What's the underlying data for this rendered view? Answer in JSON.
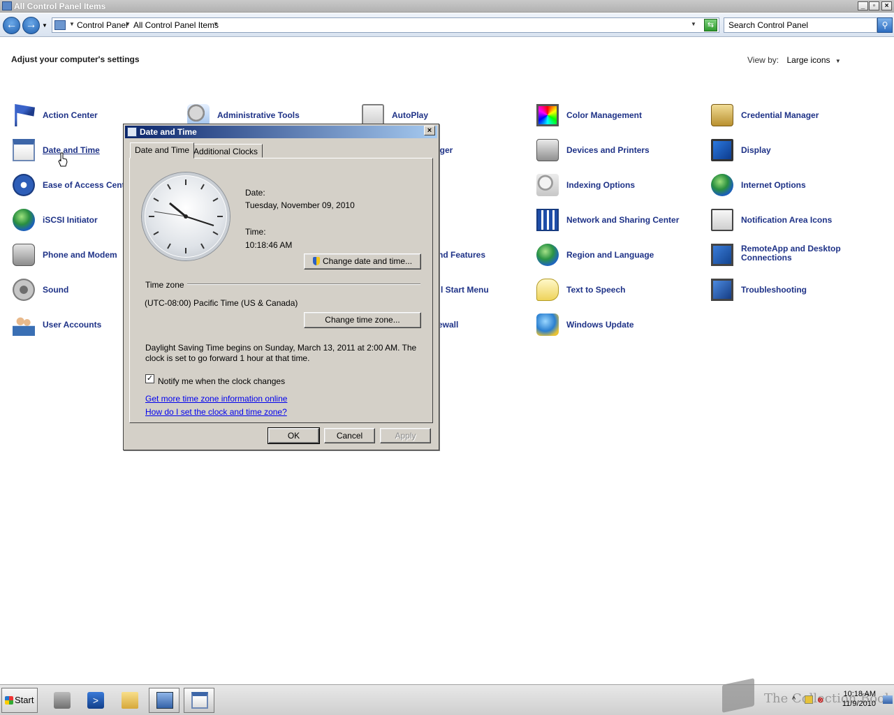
{
  "window": {
    "title": "All Control Panel Items"
  },
  "address": {
    "crumbs": [
      "Control Panel",
      "All Control Panel Items"
    ],
    "search_placeholder": "Search Control Panel"
  },
  "content": {
    "heading": "Adjust your computer's settings",
    "view_by_label": "View by:",
    "view_by_value": "Large icons"
  },
  "items": [
    {
      "label": "Action Center",
      "icon": "flag-icon"
    },
    {
      "label": "Administrative Tools",
      "icon": "admin-tools-icon"
    },
    {
      "label": "AutoPlay",
      "icon": "autoplay-icon"
    },
    {
      "label": "Color Management",
      "icon": "color-management-icon"
    },
    {
      "label": "Credential Manager",
      "icon": "credential-manager-icon"
    },
    {
      "label": "Date and Time",
      "icon": "calendar-clock-icon"
    },
    {
      "label": "ager",
      "icon": ""
    },
    {
      "label": "Devices and Printers",
      "icon": "printer-icon"
    },
    {
      "label": "Display",
      "icon": "monitor-icon"
    },
    {
      "label": "Ease of Access Cente",
      "icon": "ease-of-access-icon"
    },
    {
      "label": "Indexing Options",
      "icon": "indexing-icon"
    },
    {
      "label": "Internet Options",
      "icon": "globe-icon"
    },
    {
      "label": "iSCSI Initiator",
      "icon": "iscsi-globe-icon"
    },
    {
      "label": "Network and Sharing Center",
      "icon": "network-icon"
    },
    {
      "label": "Notification Area Icons",
      "icon": "notification-area-icon"
    },
    {
      "label": "Phone and Modem",
      "icon": "phone-icon"
    },
    {
      "label": "nd Features",
      "icon": ""
    },
    {
      "label": "Region and Language",
      "icon": "region-globe-icon"
    },
    {
      "label": "RemoteApp and Desktop Connections",
      "icon": "remoteapp-icon"
    },
    {
      "label": "Sound",
      "icon": "speaker-icon"
    },
    {
      "label": "l Start Menu",
      "icon": ""
    },
    {
      "label": "Text to Speech",
      "icon": "speech-bubble-icon"
    },
    {
      "label": "Troubleshooting",
      "icon": "troubleshooting-icon"
    },
    {
      "label": "User Accounts",
      "icon": "users-icon"
    },
    {
      "label": "ewall",
      "icon": ""
    },
    {
      "label": "Windows Update",
      "icon": "windows-update-icon"
    }
  ],
  "dialog": {
    "title": "Date and Time",
    "tabs": [
      "Date and Time",
      "Additional Clocks"
    ],
    "date_label": "Date:",
    "date_value": "Tuesday, November 09, 2010",
    "time_label": "Time:",
    "time_value": "10:18:46 AM",
    "change_datetime_btn": "Change date and time...",
    "timezone_label": "Time zone",
    "timezone_value": "(UTC-08:00) Pacific Time (US & Canada)",
    "change_tz_btn": "Change time zone...",
    "dst_text": "Daylight Saving Time begins on Sunday, March 13, 2011 at 2:00 AM. The clock is set to go forward 1 hour at that time.",
    "notify_label": "Notify me when the clock changes",
    "notify_checked": true,
    "link_more": "Get more time zone information online",
    "link_how": "How do I set the clock and time zone?",
    "ok": "OK",
    "cancel": "Cancel",
    "apply": "Apply"
  },
  "taskbar": {
    "start_label": "Start",
    "clock_time": "10:18 AM",
    "clock_date": "11/9/2010"
  },
  "watermark": {
    "text": "The Collection Book"
  }
}
